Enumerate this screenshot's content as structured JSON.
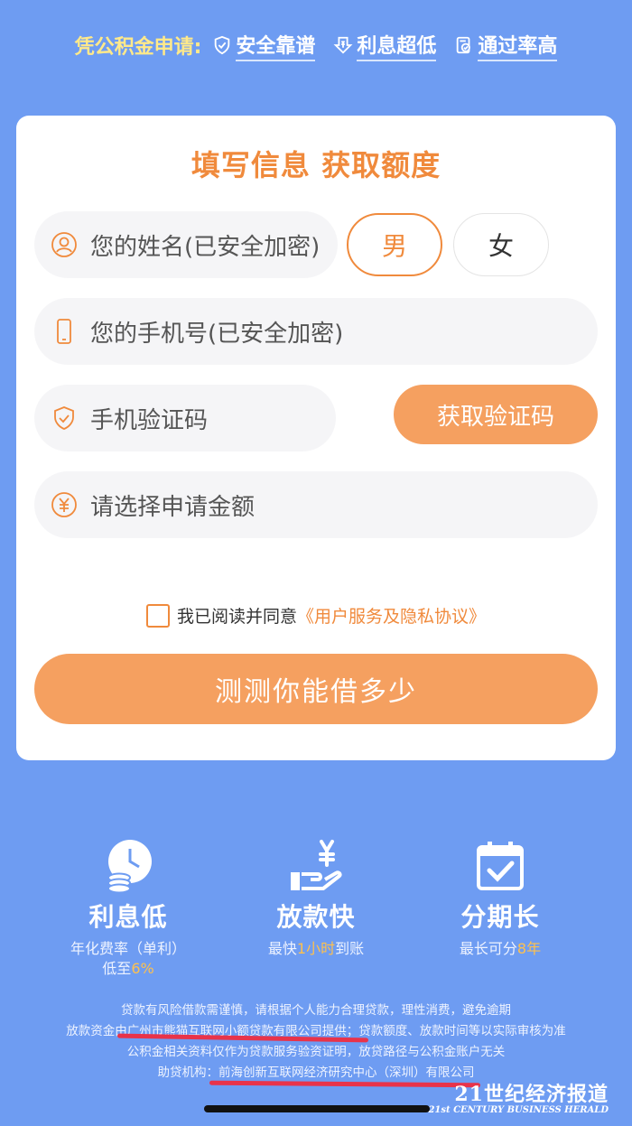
{
  "header": {
    "lead": "凭公积金申请:",
    "features": [
      {
        "icon": "shield-check-icon",
        "label": "安全靠谱"
      },
      {
        "icon": "down-arrow-coin-icon",
        "label": "利息超低"
      },
      {
        "icon": "approval-document-icon",
        "label": "通过率高"
      }
    ]
  },
  "form": {
    "title": "填写信息 获取额度",
    "name_placeholder": "您的姓名(已安全加密)",
    "gender_male": "男",
    "gender_female": "女",
    "phone_placeholder": "您的手机号(已安全加密)",
    "code_placeholder": "手机验证码",
    "get_code_label": "获取验证码",
    "amount_placeholder": "请选择申请金额",
    "agree_text": "我已阅读并同意",
    "agree_link": "《用户服务及隐私协议》",
    "submit_label": "测测你能借多少"
  },
  "perks": [
    {
      "icon": "clock-coins-icon",
      "title": "利息低",
      "sub1": "年化费率（单利）",
      "sub2_prefix": "低至",
      "sub2_highlight": "6%",
      "sub2_suffix": ""
    },
    {
      "icon": "hand-money-icon",
      "title": "放款快",
      "sub1_prefix": "最快",
      "sub1_highlight": "1小时",
      "sub1_suffix": "到账"
    },
    {
      "icon": "calendar-check-icon",
      "title": "分期长",
      "sub1_prefix": "最长可分",
      "sub1_highlight": "8年",
      "sub1_suffix": ""
    }
  ],
  "footer": {
    "line1": "贷款有风险借款需谨慎，请根据个人能力合理贷款，理性消费，避免逾期",
    "line2": "放款资金由广州市熊猫互联网小额贷款有限公司提供；贷款额度、放款时间等以实际审核为准",
    "line3": "公积金相关资料仅作为贷款服务验资证明，放贷路径与公积金账户无关",
    "line4": "助贷机构：前海创新互联网经济研究中心（深圳）有限公司"
  },
  "watermark": {
    "main": "21世纪经济报道",
    "sub": "21st CENTURY BUSINESS HERALD"
  },
  "colors": {
    "background": "#6e9cf2",
    "accent": "#f08a3c",
    "button": "#f5a060",
    "highlight": "#ffc14d",
    "annotation_red": "#e8334a"
  }
}
